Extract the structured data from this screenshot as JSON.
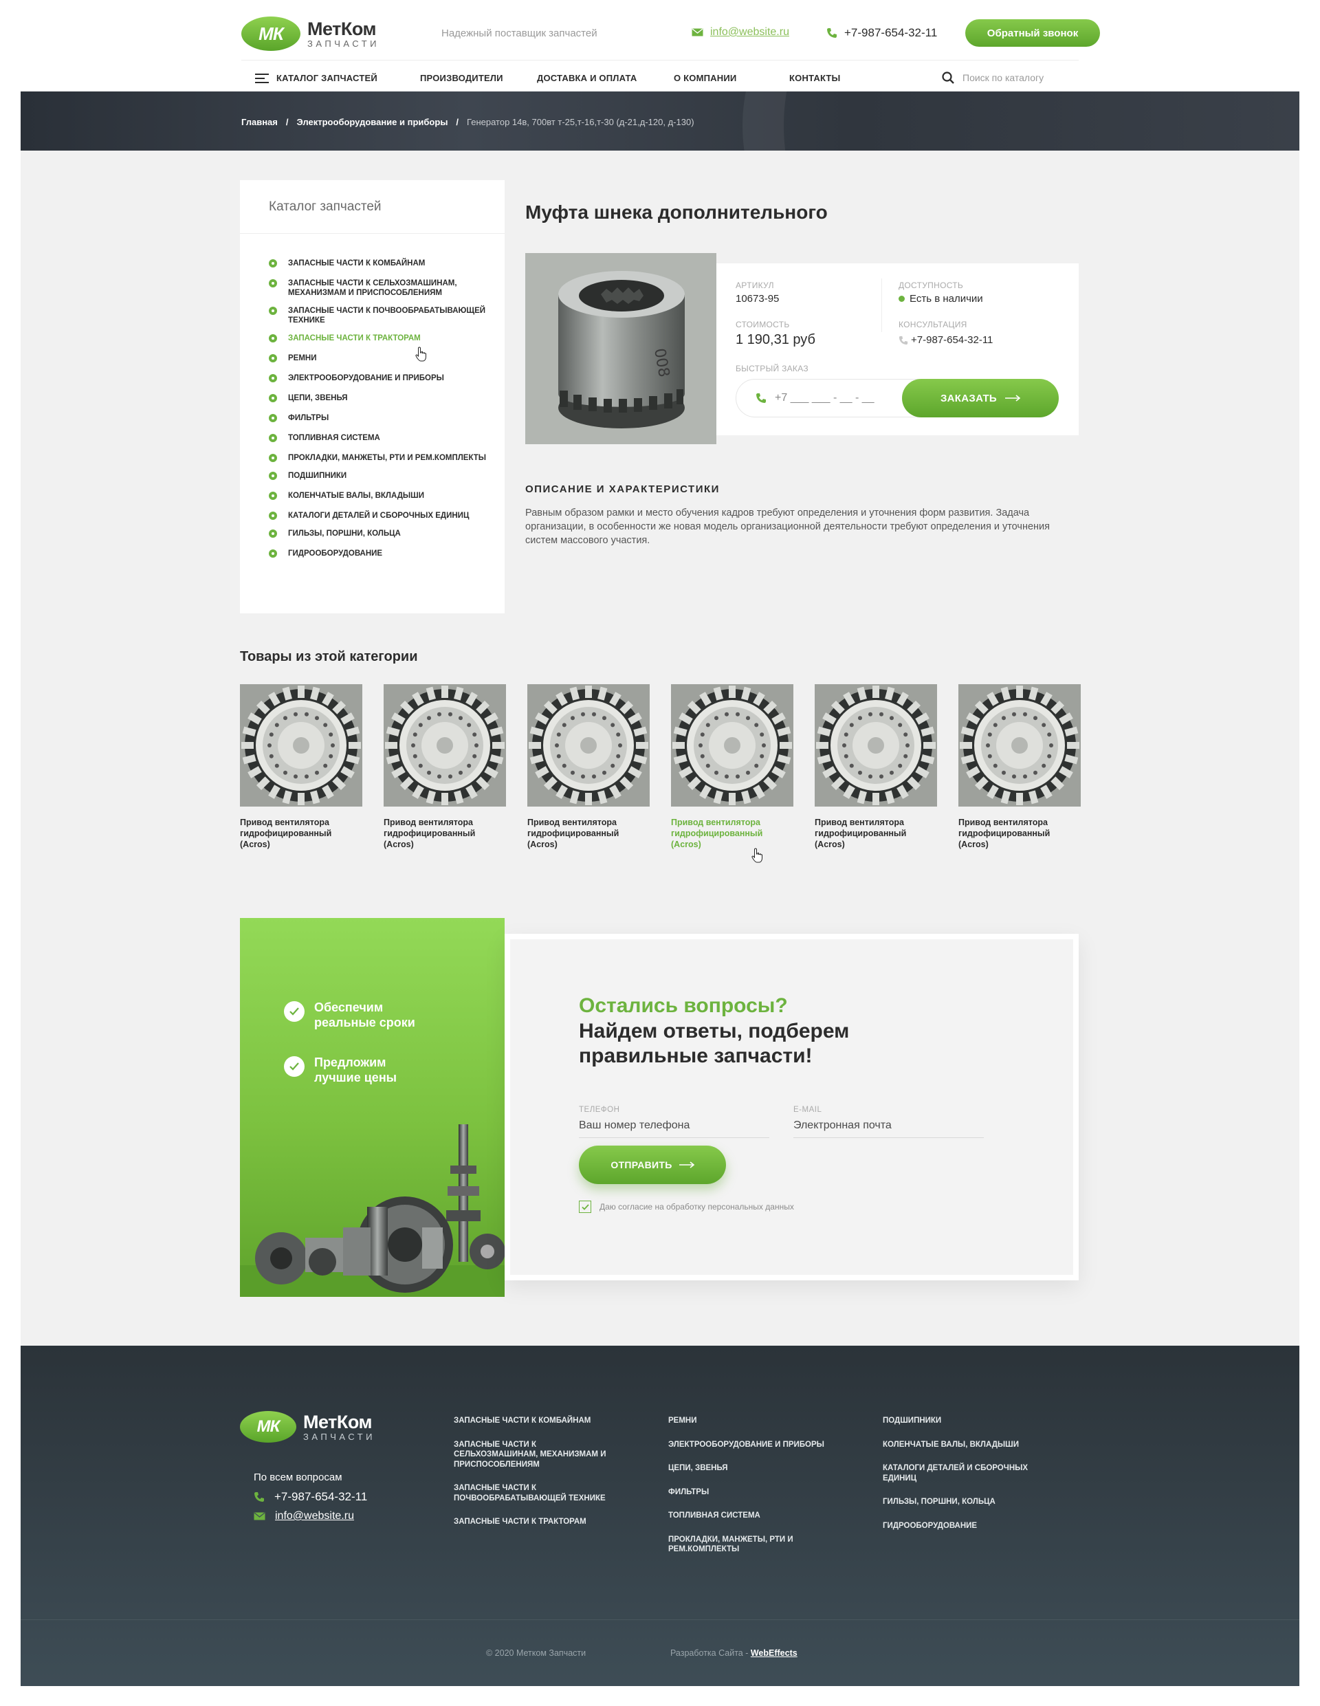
{
  "header": {
    "logo_mark": "МК",
    "logo_name": "МетКом",
    "logo_sub": "ЗАПЧАСТИ",
    "tagline": "Надежный поставщик запчастей",
    "email": "info@website.ru",
    "phone": "+7-987-654-32-11",
    "callback_label": "Обратный звонок"
  },
  "nav": {
    "catalog": "КАТАЛОГ ЗАПЧАСТЕЙ",
    "manufacturers": "ПРОИЗВОДИТЕЛИ",
    "delivery": "ДОСТАВКА И ОПЛАТА",
    "about": "О КОМПАНИИ",
    "contacts": "КОНТАКТЫ",
    "search_placeholder": "Поиск по каталогу"
  },
  "breadcrumbs": [
    "Главная",
    "/",
    "Электрооборудование и приборы",
    "/",
    "Генератор 14в, 700вт т-25,т-16,т-30 (д-21,д-120, д-130)"
  ],
  "sidebar": {
    "title": "Каталог запчастей",
    "items": [
      "ЗАПАСНЫЕ ЧАСТИ К КОМБАЙНАМ",
      "ЗАПАСНЫЕ ЧАСТИ К СЕЛЬХОЗМАШИНАМ, МЕХАНИЗМАМ И ПРИСПОСОБЛЕНИЯМ",
      "ЗАПАСНЫЕ ЧАСТИ К ПОЧВООБРАБАТЫВАЮЩЕЙ ТЕХНИКЕ",
      "ЗАПАСНЫЕ ЧАСТИ К ТРАКТОРАМ",
      "РЕМНИ",
      "ЭЛЕКТРООБОРУДОВАНИЕ И ПРИБОРЫ",
      "ЦЕПИ, ЗВЕНЬЯ",
      "ФИЛЬТРЫ",
      "ТОПЛИВНАЯ СИСТЕМА",
      "ПРОКЛАДКИ, МАНЖЕТЫ, РТИ И РЕМ.КОМПЛЕКТЫ",
      "ПОДШИПНИКИ",
      "КОЛЕНЧАТЫЕ ВАЛЫ, ВКЛАДЫШИ",
      "КАТАЛОГИ ДЕТАЛЕЙ И СБОРОЧНЫХ ЕДИНИЦ",
      "ГИЛЬЗЫ, ПОРШНИ, КОЛЬЦА",
      "ГИДРООБОРУДОВАНИЕ"
    ],
    "active_index": 3
  },
  "product": {
    "title": "Муфта шнека дополнительного",
    "sku_label": "АРТИКУЛ",
    "sku": "10673-95",
    "availability_label": "ДОСТУПНОСТЬ",
    "availability": "Есть в наличии",
    "price_label": "СТОИМОСТЬ",
    "price": "1 190,31 руб",
    "consult_label": "КОНСУЛЬТАЦИЯ",
    "consult_phone": "+7-987-654-32-11",
    "quick_label": "БЫСТРЫЙ ЗАКАЗ",
    "quick_placeholder": "+7 ___ ___ - __ - __",
    "order_label": "ЗАКАЗАТЬ",
    "desc_title": "ОПИСАНИЕ И ХАРАКТЕРИСТИКИ",
    "desc_text": "Равным образом рамки и место обучения кадров требуют определения и уточнения форм развития. Задача организации, в особенности же новая модель организационной деятельности требуют определения и уточнения систем массового участия."
  },
  "related": {
    "title": "Товары из этой категории",
    "items": [
      "Привод вентилятора гидрофицированный (Acros)",
      "Привод вентилятора гидрофицированный (Acros)",
      "Привод вентилятора гидрофицированный (Acros)",
      "Привод вентилятора гидрофицированный (Acros)",
      "Привод вентилятора гидрофицированный (Acros)",
      "Привод вентилятора гидрофицированный (Acros)"
    ],
    "hover_index": 3
  },
  "cta": {
    "feature1": "Обеспечим реальные сроки",
    "feature2": "Предложим лучшие цены",
    "question": "Остались вопросы?",
    "headline": "Найдем ответы, подберем правильные запчасти!",
    "phone_label": "ТЕЛЕФОН",
    "phone_placeholder": "Ваш номер телефона",
    "email_label": "E-MAIL",
    "email_placeholder": "Электронная почта",
    "send_label": "ОТПРАВИТЬ",
    "consent": "Даю согласие на обработку персональных данных"
  },
  "footer": {
    "logo_mark": "МК",
    "logo_name": "МетКом",
    "logo_sub": "ЗАПЧАСТИ",
    "questions": "По всем вопросам",
    "phone": "+7-987-654-32-11",
    "email": "info@website.ru",
    "col1": [
      "ЗАПАСНЫЕ ЧАСТИ К КОМБАЙНАМ",
      "ЗАПАСНЫЕ ЧАСТИ К СЕЛЬХОЗМАШИНАМ, МЕХАНИЗМАМ И ПРИСПОСОБЛЕНИЯМ",
      "ЗАПАСНЫЕ ЧАСТИ К ПОЧВООБРАБАТЫВАЮЩЕЙ ТЕХНИКЕ",
      "ЗАПАСНЫЕ ЧАСТИ К ТРАКТОРАМ"
    ],
    "col2": [
      "РЕМНИ",
      "ЭЛЕКТРООБОРУДОВАНИЕ И ПРИБОРЫ",
      "ЦЕПИ, ЗВЕНЬЯ",
      "ФИЛЬТРЫ",
      "ТОПЛИВНАЯ СИСТЕМА",
      "ПРОКЛАДКИ, МАНЖЕТЫ, РТИ И РЕМ.КОМПЛЕКТЫ"
    ],
    "col3": [
      "ПОДШИПНИКИ",
      "КОЛЕНЧАТЫЕ ВАЛЫ, ВКЛАДЫШИ",
      "КАТАЛОГИ ДЕТАЛЕЙ И СБОРОЧНЫХ ЕДИНИЦ",
      "ГИЛЬЗЫ, ПОРШНИ, КОЛЬЦА",
      "ГИДРООБОРУДОВАНИЕ"
    ],
    "copyright": "© 2020 Метком Запчасти",
    "dev_prefix": "Разработка Сайта - ",
    "dev_name": "WebEffects"
  },
  "colors": {
    "accent": "#6db33f",
    "dark": "#2b3339",
    "text": "#2c2c2c"
  },
  "icons": [
    "hamburger-menu-icon",
    "search-icon",
    "mail-icon",
    "phone-icon",
    "arrow-right-icon",
    "check-icon",
    "pointer-cursor-icon"
  ]
}
